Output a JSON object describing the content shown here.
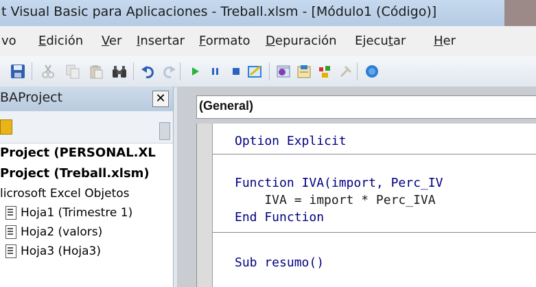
{
  "window": {
    "title": "t Visual Basic para Aplicaciones - Treball.xlsm - [Módulo1 (Código)]"
  },
  "menu": [
    {
      "label": "vo",
      "accel": ""
    },
    {
      "label": "Edición",
      "accel": "E"
    },
    {
      "label": "Ver",
      "accel": "V"
    },
    {
      "label": "Insertar",
      "accel": "I"
    },
    {
      "label": "Formato",
      "accel": "F"
    },
    {
      "label": "Depuración",
      "accel": "D"
    },
    {
      "label": "Ejecutar",
      "accel": "t"
    },
    {
      "label": "Her",
      "accel": "H"
    }
  ],
  "toolbar": {
    "icons": [
      "save-icon",
      "cut-icon",
      "copy-icon",
      "paste-icon",
      "find-icon",
      "undo-icon",
      "redo-icon",
      "run-icon",
      "break-icon",
      "reset-icon",
      "design-mode-icon",
      "project-explorer-icon",
      "properties-icon",
      "object-browser-icon",
      "toolbox-icon",
      "help-icon"
    ]
  },
  "project": {
    "title": "BAProject",
    "close_label": "✕",
    "tree": [
      {
        "label": "Project (PERSONAL.XL",
        "bold": true
      },
      {
        "label": "Project (Treball.xlsm)",
        "bold": true
      },
      {
        "label": "licrosoft Excel Objetos",
        "bold": false
      },
      {
        "label": "Hoja1 (Trimestre 1)",
        "bold": false
      },
      {
        "label": "Hoja2 (valors)",
        "bold": false
      },
      {
        "label": "Hoja3 (Hoja3)",
        "bold": false
      }
    ]
  },
  "code_window": {
    "object_combo": "(General)",
    "lines": [
      "Option Explicit",
      "Function IVA(import, Perc_IV",
      "    IVA = import * Perc_IVA",
      "End Function",
      "Sub resumo()"
    ]
  },
  "colors": {
    "keyword": "#000080",
    "title_bar": "#b4cbe4"
  }
}
